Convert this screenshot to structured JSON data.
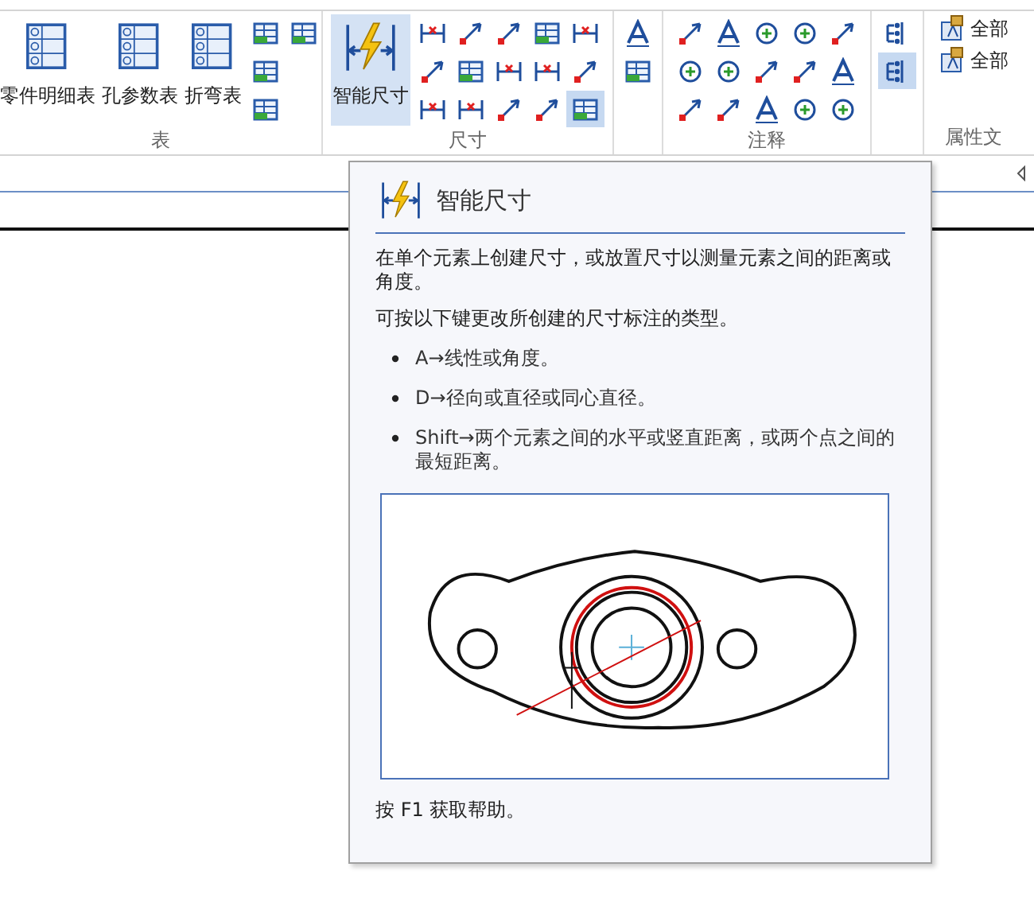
{
  "ribbon": {
    "groups": [
      {
        "kind": "table",
        "label": "表",
        "big_buttons": [
          {
            "label": "零件明细表",
            "selected": false
          },
          {
            "label": "孔参数表",
            "selected": false
          },
          {
            "label": "折弯表",
            "selected": false
          }
        ],
        "tools": [
          {
            "active": false
          },
          {
            "active": false
          },
          {
            "active": false
          },
          {
            "active": false
          }
        ]
      },
      {
        "kind": "dimension",
        "label": "尺寸",
        "big_buttons": [
          {
            "label": "智能尺寸",
            "selected": true
          }
        ],
        "tools": [
          {
            "active": false
          },
          {
            "active": false
          },
          {
            "active": false
          },
          {
            "active": false
          },
          {
            "active": false
          },
          {
            "active": false
          },
          {
            "active": false
          },
          {
            "active": false
          },
          {
            "active": false
          },
          {
            "active": false
          },
          {
            "active": false
          },
          {
            "active": false
          },
          {
            "active": false
          },
          {
            "active": false
          },
          {
            "active": true
          }
        ]
      },
      {
        "kind": "style",
        "tools": [
          {
            "active": false
          },
          {
            "active": false
          }
        ]
      },
      {
        "kind": "annotation",
        "label": "注释",
        "tools": [
          {
            "active": false
          },
          {
            "active": false
          },
          {
            "active": false
          },
          {
            "active": false
          },
          {
            "active": false
          },
          {
            "active": false
          },
          {
            "active": false
          },
          {
            "active": false
          },
          {
            "active": false
          },
          {
            "active": false
          },
          {
            "active": false
          },
          {
            "active": false
          },
          {
            "active": false
          },
          {
            "active": false
          },
          {
            "active": false
          }
        ]
      },
      {
        "kind": "layer",
        "tools": [
          {
            "active": false
          },
          {
            "active": true
          }
        ]
      },
      {
        "kind": "property",
        "label": "属性文",
        "items": [
          {
            "label": "全部"
          },
          {
            "label": "全部"
          }
        ]
      }
    ]
  },
  "tooltip": {
    "title": "智能尺寸",
    "description": "在单个元素上创建尺寸，或放置尺寸以测量元素之间的距离或角度。",
    "keys_intro": "可按以下键更改所创建的尺寸标注的类型。",
    "bullets": [
      "A→线性或角度。",
      "D→径向或直径或同心直径。",
      "Shift→两个元素之间的水平或竖直距离，或两个点之间的最短距离。"
    ],
    "footer": "按 F1 获取帮助。"
  }
}
